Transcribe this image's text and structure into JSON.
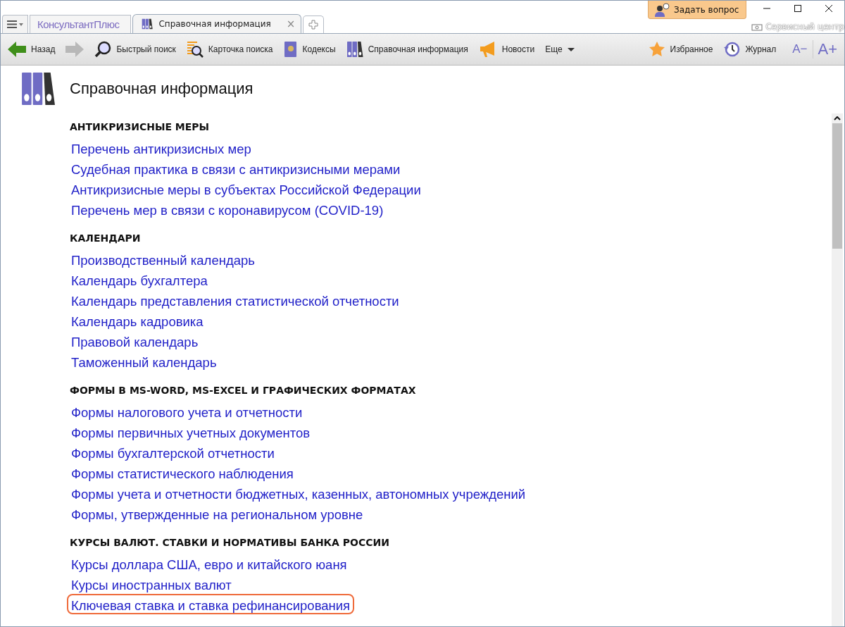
{
  "app_tab": {
    "logo": "КонсультантПлюс"
  },
  "tabs": [
    {
      "label": "Справочная информация",
      "selected": true,
      "close": "×"
    }
  ],
  "ask_button": "Задать вопрос",
  "service_center": "Сервисный центр",
  "toolbar": [
    {
      "kind": "back",
      "label": "Назад"
    },
    {
      "kind": "forward"
    },
    {
      "kind": "search",
      "label": "Быстрый поиск"
    },
    {
      "kind": "card",
      "label": "Карточка поиска"
    },
    {
      "kind": "codes",
      "label": "Кодексы"
    },
    {
      "kind": "ref",
      "label": "Справочная информация"
    },
    {
      "kind": "news",
      "label": "Новости"
    },
    {
      "kind": "more",
      "label": "Еще"
    },
    {
      "kind": "spacer"
    },
    {
      "kind": "fav",
      "label": "Избранное"
    },
    {
      "kind": "journal",
      "label": "Журнал"
    }
  ],
  "font_buttons": [
    "A−",
    "A+"
  ],
  "page_title": "Справочная информация",
  "sections": [
    {
      "heading": "АНТИКРИЗИСНЫЕ МЕРЫ",
      "links": [
        {
          "text": "Перечень антикризисных мер",
          "highlighted": false
        },
        {
          "text": "Судебная практика в связи с антикризисными мерами",
          "highlighted": false
        },
        {
          "text": "Антикризисные меры в субъектах Российской Федерации",
          "highlighted": false
        },
        {
          "text": "Перечень мер в связи с коронавирусом (COVID-19)",
          "highlighted": false
        }
      ]
    },
    {
      "heading": "КАЛЕНДАРИ",
      "links": [
        {
          "text": "Производственный календарь",
          "highlighted": false
        },
        {
          "text": "Календарь бухгалтера",
          "highlighted": false
        },
        {
          "text": "Календарь представления статистической отчетности",
          "highlighted": false
        },
        {
          "text": "Календарь кадровика",
          "highlighted": false
        },
        {
          "text": "Правовой календарь",
          "highlighted": false
        },
        {
          "text": "Таможенный календарь",
          "highlighted": false
        }
      ]
    },
    {
      "heading": "ФОРМЫ В MS-WORD, MS-EXCEL И ГРАФИЧЕСКИХ ФОРМАТАХ",
      "links": [
        {
          "text": "Формы налогового учета и отчетности",
          "highlighted": false
        },
        {
          "text": "Формы первичных учетных документов",
          "highlighted": false
        },
        {
          "text": "Формы бухгалтерской отчетности",
          "highlighted": false
        },
        {
          "text": "Формы статистического наблюдения",
          "highlighted": false
        },
        {
          "text": "Формы учета и отчетности бюджетных, казенных, автономных учреждений",
          "highlighted": false
        },
        {
          "text": "Формы, утвержденные на региональном уровне",
          "highlighted": false
        }
      ]
    },
    {
      "heading": "КУРСЫ ВАЛЮТ. СТАВКИ И НОРМАТИВЫ БАНКА РОССИИ",
      "links": [
        {
          "text": "Курсы доллара США, евро и китайского юаня",
          "highlighted": false
        },
        {
          "text": "Курсы иностранных валют",
          "highlighted": false
        },
        {
          "text": "Ключевая ставка и ставка рефинансирования",
          "highlighted": true
        }
      ]
    }
  ]
}
